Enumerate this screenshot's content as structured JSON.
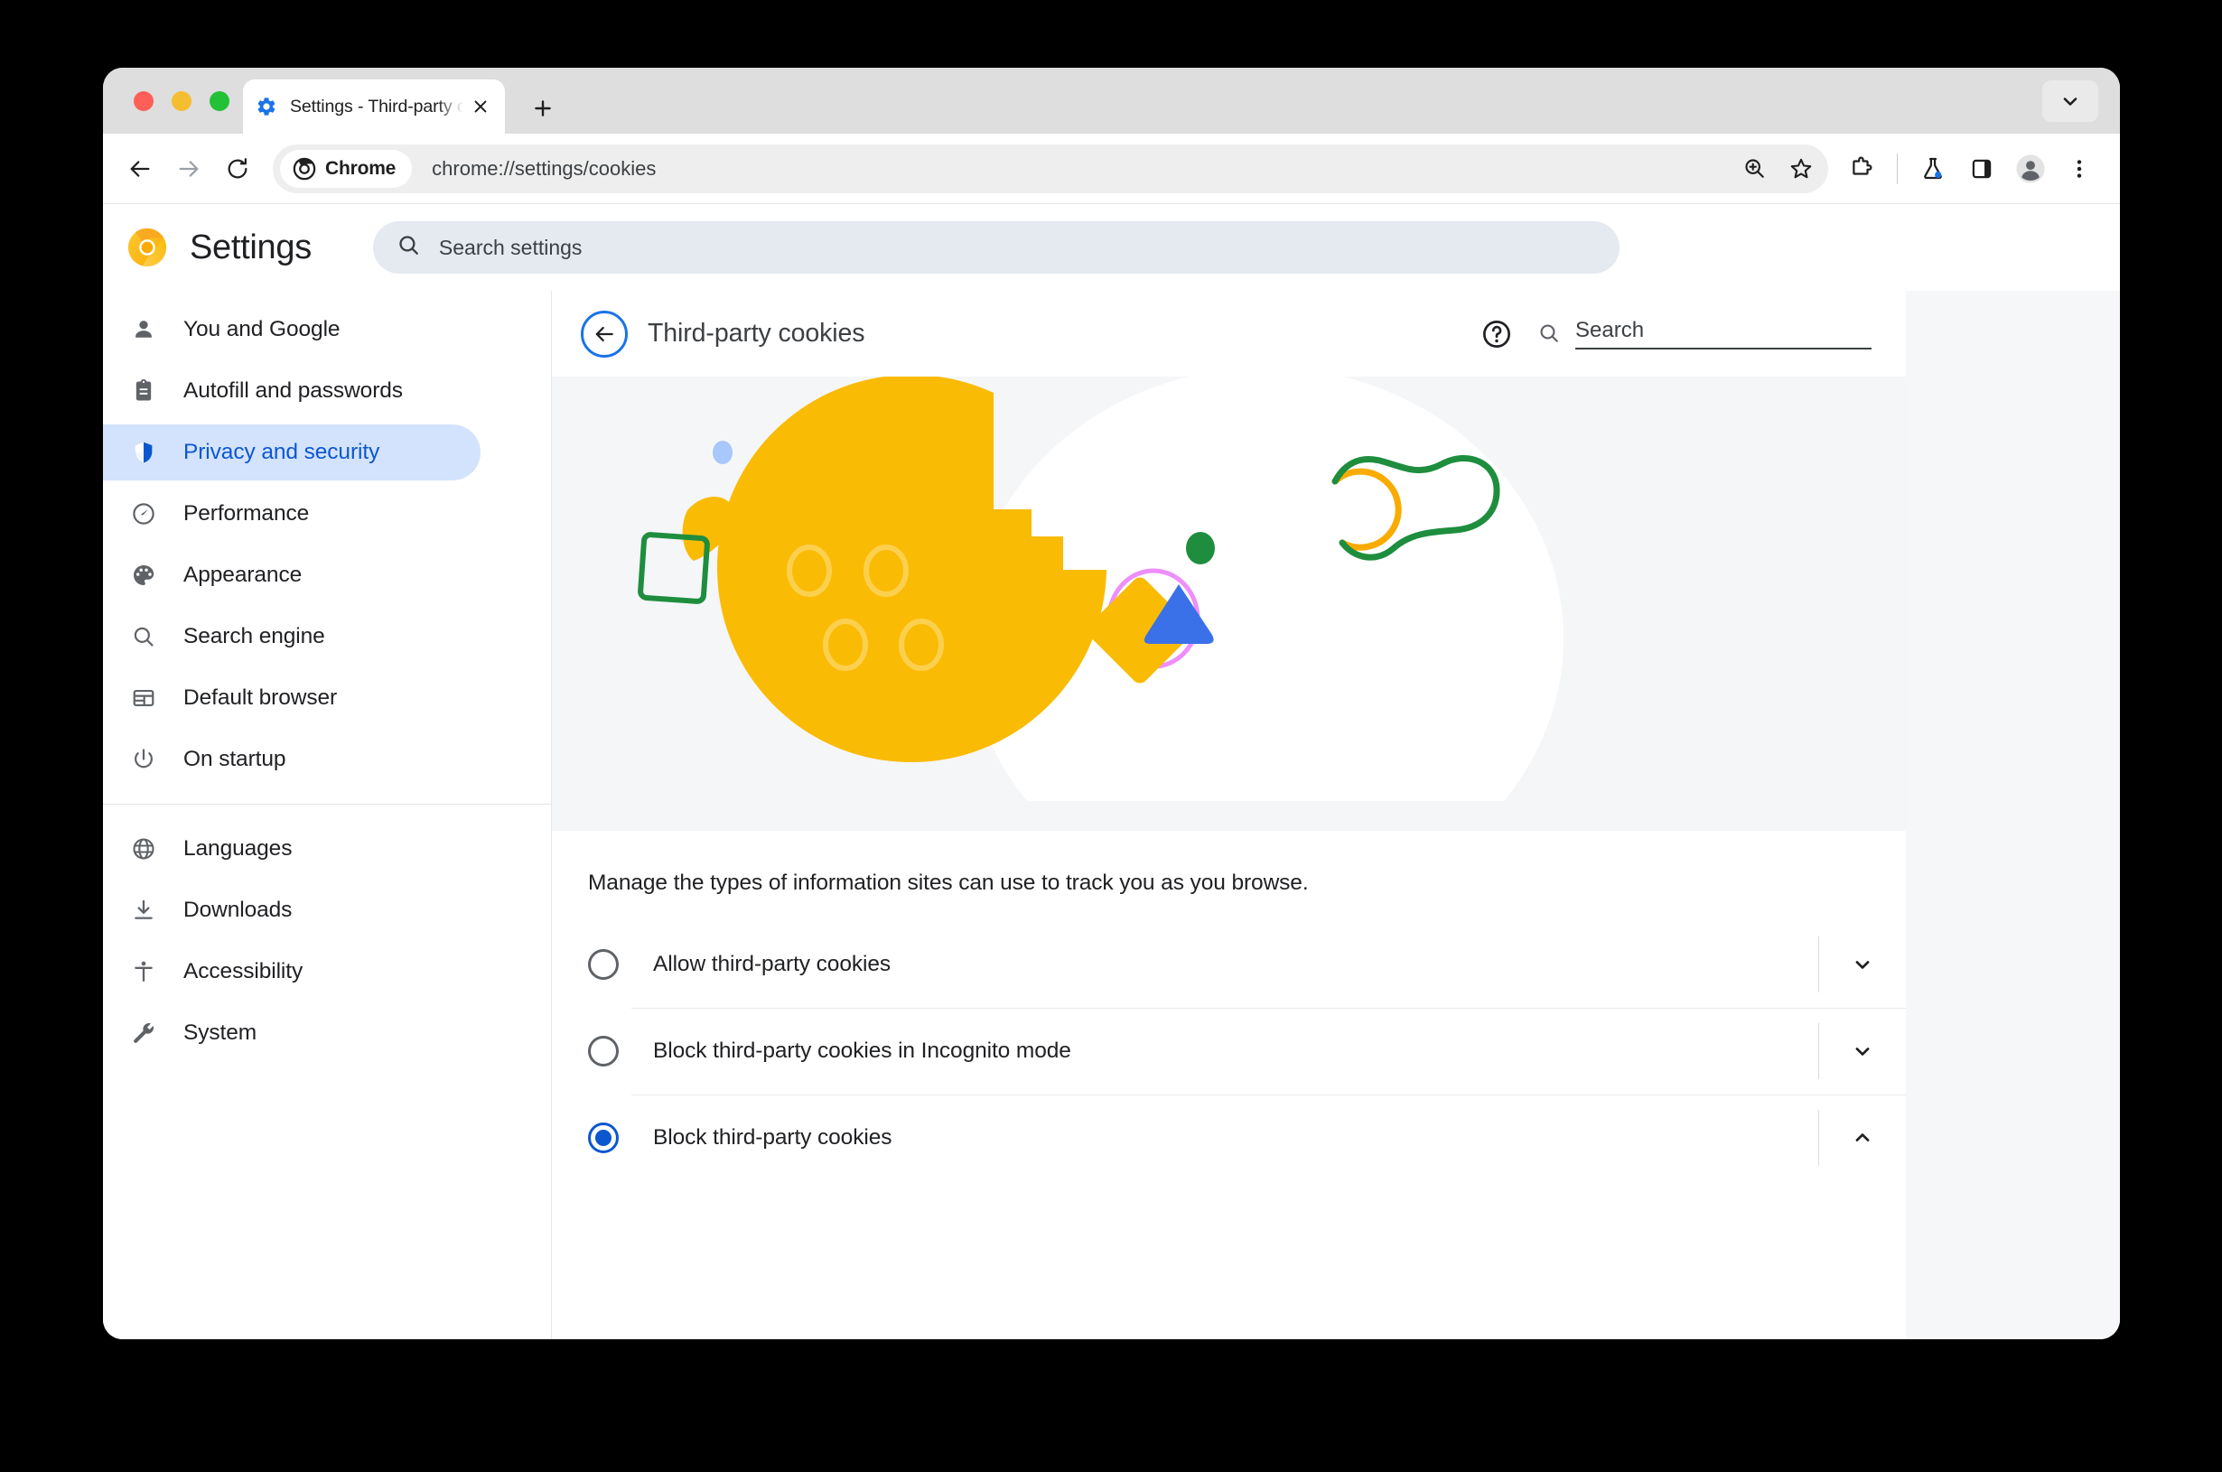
{
  "window": {
    "traffic_lights": [
      "close",
      "minimize",
      "maximize"
    ],
    "tab": {
      "title": "Settings - Third-party cookie",
      "favicon": "gear-icon",
      "close_icon": "close-icon"
    },
    "new_tab_label": "+",
    "tab_list_icon": "chevron-down-icon"
  },
  "toolbar": {
    "back_icon": "arrow-left-icon",
    "forward_icon": "arrow-right-icon",
    "reload_icon": "reload-icon",
    "chip_label": "Chrome",
    "chip_icon": "chrome-icon",
    "url": "chrome://settings/cookies",
    "zoom_icon": "zoom-in-icon",
    "bookmark_icon": "star-icon",
    "extensions_icon": "puzzle-icon",
    "experiments_icon": "flask-icon",
    "side_panel_icon": "side-panel-icon",
    "profile_icon": "avatar-icon",
    "menu_icon": "three-dot-menu-icon"
  },
  "settings_header": {
    "logo": "chrome-canary-logo",
    "title": "Settings",
    "search_icon": "search-icon",
    "search_placeholder": "Search settings",
    "search_value": ""
  },
  "sidebar": {
    "groups": [
      {
        "items": [
          {
            "label": "You and Google",
            "icon": "person-icon",
            "active": false
          },
          {
            "label": "Autofill and passwords",
            "icon": "clipboard-icon",
            "active": false
          },
          {
            "label": "Privacy and security",
            "icon": "shield-icon",
            "active": true
          },
          {
            "label": "Performance",
            "icon": "speedometer-icon",
            "active": false
          },
          {
            "label": "Appearance",
            "icon": "palette-icon",
            "active": false
          },
          {
            "label": "Search engine",
            "icon": "magnifier-icon",
            "active": false
          },
          {
            "label": "Default browser",
            "icon": "browser-window-icon",
            "active": false
          },
          {
            "label": "On startup",
            "icon": "power-icon",
            "active": false
          }
        ]
      },
      {
        "items": [
          {
            "label": "Languages",
            "icon": "globe-icon",
            "active": false
          },
          {
            "label": "Downloads",
            "icon": "download-icon",
            "active": false
          },
          {
            "label": "Accessibility",
            "icon": "accessibility-icon",
            "active": false
          },
          {
            "label": "System",
            "icon": "wrench-icon",
            "active": false
          }
        ]
      }
    ]
  },
  "content": {
    "back_icon": "arrow-left-icon",
    "title": "Third-party cookies",
    "help_icon": "help-circle-icon",
    "search_icon": "search-icon",
    "search_placeholder": "Search",
    "search_value": "",
    "illustration": {
      "name": "cookie-illustration",
      "colors": {
        "background": "#f5f6f8",
        "cookie": "#fabb05",
        "cookie_hole": "#fcd04f",
        "white_blob": "#ffffff",
        "gray_pill": "#e3e5e8",
        "blue_dot": "#a8c7fa",
        "green_outline": "#1e8e3e",
        "pink_circle": "#ee8efc",
        "blue_triangle": "#3b71e8",
        "green_dot": "#1e8e3e",
        "yellow_diamond": "#fabb05"
      }
    },
    "description": "Manage the types of information sites can use to track you as you browse.",
    "options": [
      {
        "label": "Allow third-party cookies",
        "selected": false,
        "expand_icon": "chevron-down-icon"
      },
      {
        "label": "Block third-party cookies in Incognito mode",
        "selected": false,
        "expand_icon": "chevron-down-icon"
      },
      {
        "label": "Block third-party cookies",
        "selected": true,
        "expand_icon": "chevron-up-icon"
      }
    ]
  },
  "colors": {
    "accent": "#0b57d0",
    "active_nav_bg": "#d3e3fd",
    "toolbar_bg": "#ffffff",
    "tabstrip_bg": "#dedede"
  }
}
